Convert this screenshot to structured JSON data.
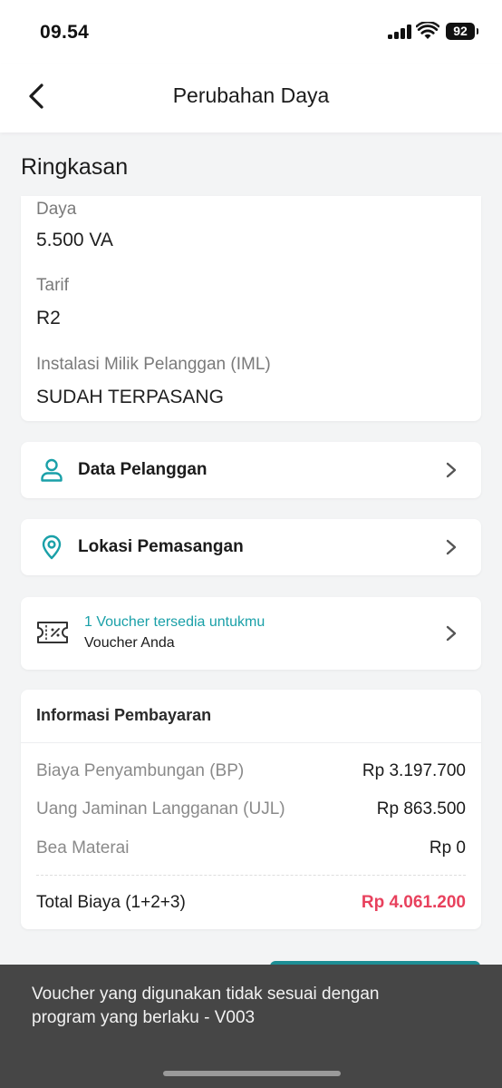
{
  "status_bar": {
    "time": "09.54",
    "battery": "92"
  },
  "header": {
    "title": "Perubahan Daya"
  },
  "summary": {
    "title": "Ringkasan",
    "fields": [
      {
        "label": "Daya",
        "value": "5.500 VA"
      },
      {
        "label": "Tarif",
        "value": "R2"
      },
      {
        "label": "Instalasi Milik Pelanggan (IML)",
        "value": "SUDAH TERPASANG"
      }
    ]
  },
  "nav": {
    "customer_data": "Data Pelanggan",
    "install_location": "Lokasi Pemasangan"
  },
  "voucher": {
    "available": "1 Voucher tersedia untukmu",
    "label": "Voucher Anda"
  },
  "payment": {
    "title": "Informasi Pembayaran",
    "rows": [
      {
        "label": "Biaya Penyambungan (BP)",
        "amount": "Rp 3.197.700"
      },
      {
        "label": "Uang Jaminan Langganan (UJL)",
        "amount": "Rp 863.500"
      },
      {
        "label": "Bea Materai",
        "amount": "Rp 0"
      }
    ],
    "total_label": "Total Biaya (1+2+3)",
    "total_amount": "Rp 4.061.200"
  },
  "toast": {
    "message": "Voucher yang digunakan tidak sesuai dengan program yang berlaku - V003"
  },
  "colors": {
    "accent": "#1aa0a8",
    "total": "#e8415d",
    "toast_bg": "#464646"
  },
  "icons": {
    "back": "chevron-left-icon",
    "customer": "person-icon",
    "location": "map-pin-icon",
    "voucher": "ticket-percent-icon",
    "chevron": "chevron-right-icon"
  }
}
